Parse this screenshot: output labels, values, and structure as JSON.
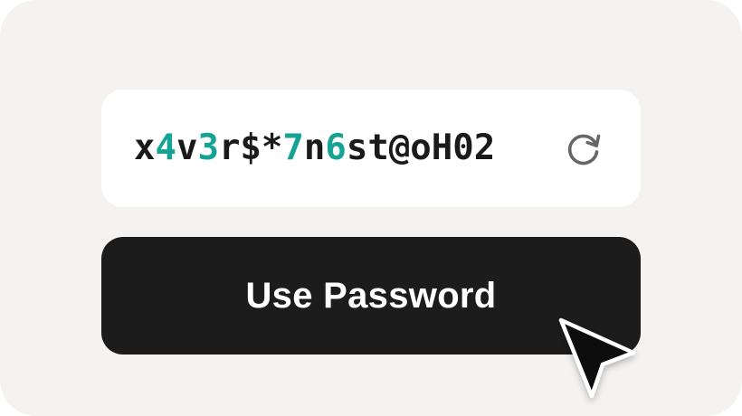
{
  "password_field": {
    "segments": [
      {
        "text": "x",
        "type": "norm"
      },
      {
        "text": "4",
        "type": "digit"
      },
      {
        "text": "v",
        "type": "norm"
      },
      {
        "text": "3",
        "type": "digit"
      },
      {
        "text": "r$*",
        "type": "norm"
      },
      {
        "text": "7",
        "type": "digit"
      },
      {
        "text": "n",
        "type": "norm"
      },
      {
        "text": "6",
        "type": "digit"
      },
      {
        "text": "st@oH02",
        "type": "norm"
      }
    ],
    "refresh_icon": "refresh-icon"
  },
  "button": {
    "label": "Use Password"
  },
  "cursor_icon": "mouse-pointer-icon",
  "colors": {
    "background": "#f4f3f1",
    "field": "#ffffff",
    "text": "#1a1a1a",
    "digit_accent": "#17a394",
    "button": "#1c1c1c",
    "button_text": "#ffffff"
  }
}
